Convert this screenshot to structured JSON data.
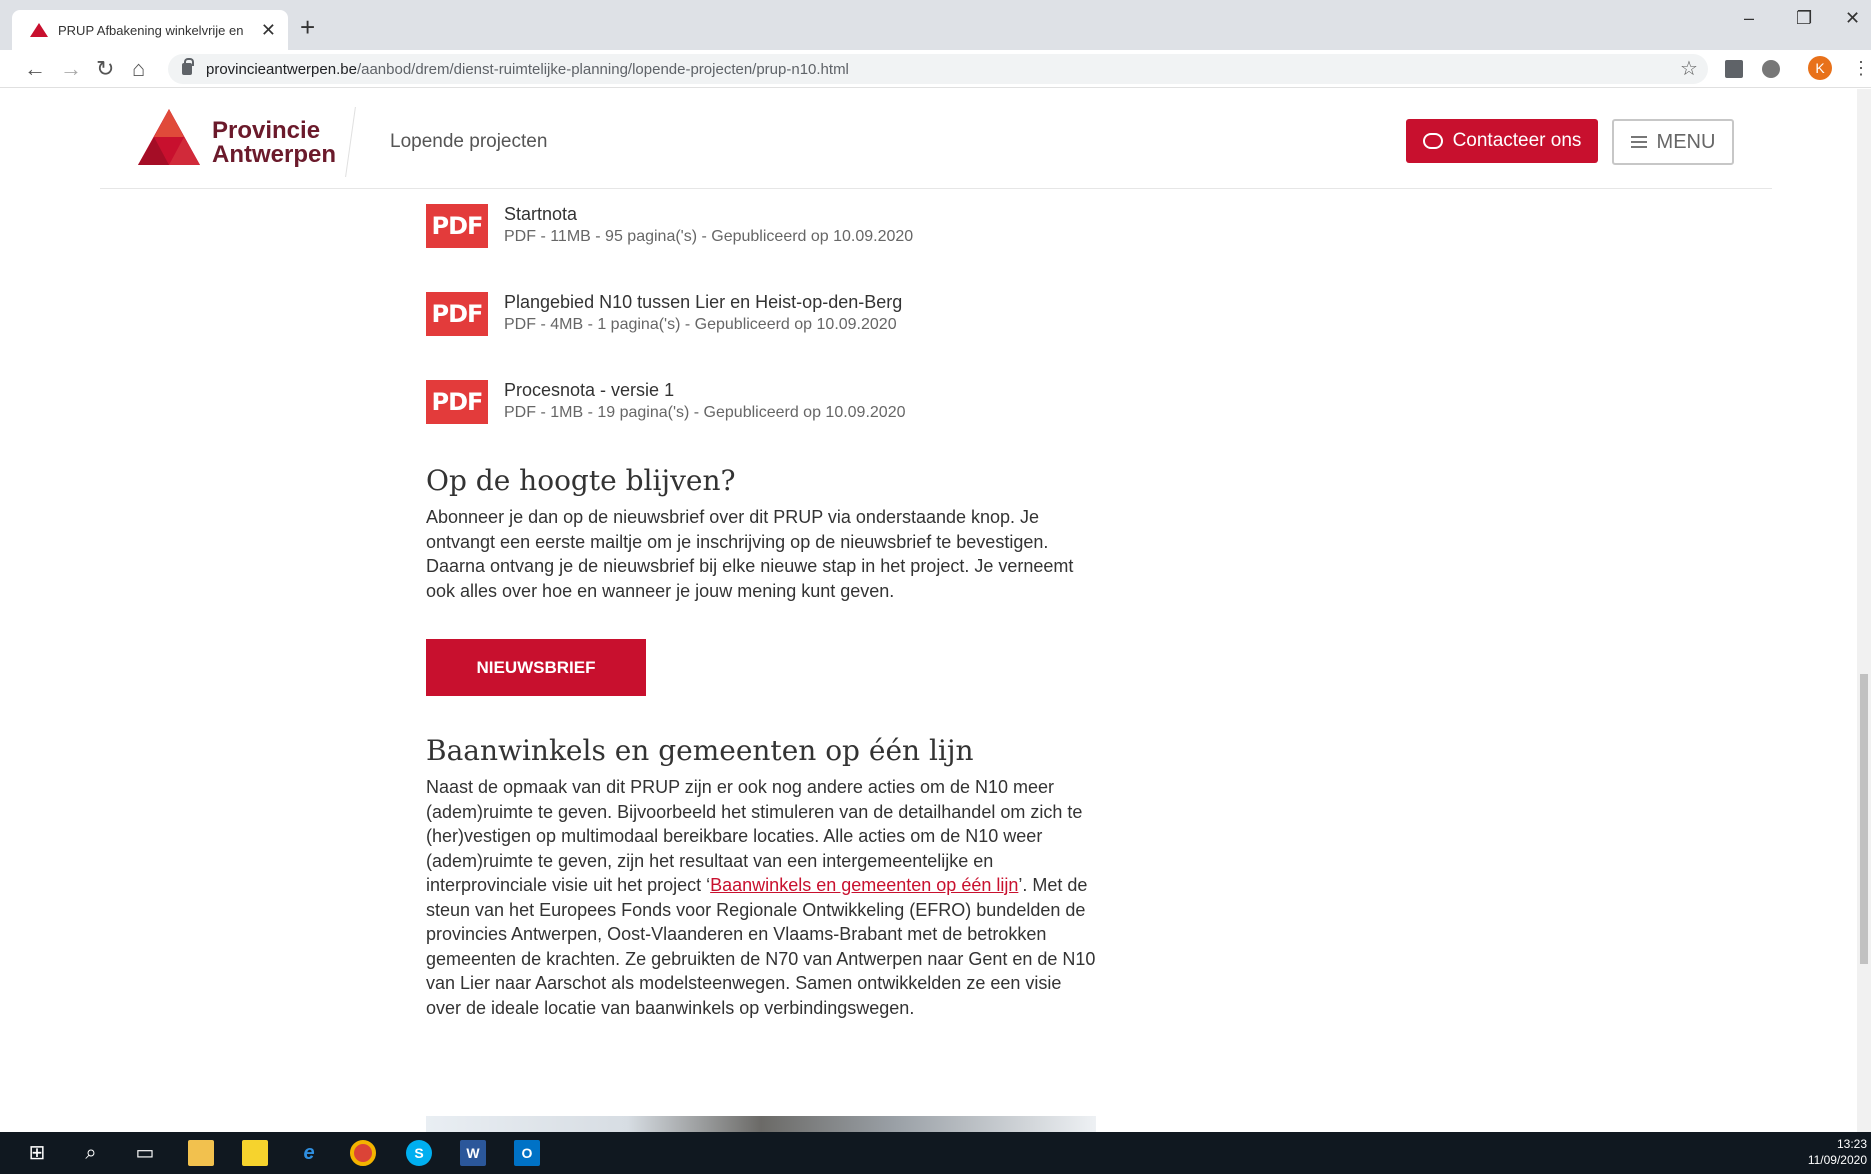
{
  "browser": {
    "tab_title": "PRUP Afbakening winkelvrije en",
    "url_host": "provincieantwerpen.be",
    "url_path": "/aanbod/drem/dienst-ruimtelijke-planning/lopende-projecten/prup-n10.html",
    "profile_initial": "K"
  },
  "header": {
    "logo_line1": "Provincie",
    "logo_line2": "Antwerpen",
    "section": "Lopende projecten",
    "contact_label": "Contacteer ons",
    "menu_label": "MENU"
  },
  "documents": [
    {
      "badge": "PDF",
      "title": "Startnota",
      "meta": "PDF - 11MB - 95 pagina('s) - Gepubliceerd op 10.09.2020"
    },
    {
      "badge": "PDF",
      "title": "Plangebied N10 tussen Lier en Heist-op-den-Berg",
      "meta": "PDF - 4MB - 1 pagina('s) - Gepubliceerd op 10.09.2020"
    },
    {
      "badge": "PDF",
      "title": "Procesnota - versie 1",
      "meta": "PDF - 1MB - 19 pagina('s) - Gepubliceerd op 10.09.2020"
    }
  ],
  "newsletter": {
    "heading": "Op de hoogte blijven?",
    "body": "Abonneer je dan op de nieuwsbrief over dit PRUP via onderstaande knop. Je ontvangt een eerste mailtje om je inschrijving op de nieuwsbrief te bevestigen. Daarna ontvang je de nieuwsbrief bij elke nieuwe stap in het project. Je verneemt ook alles over hoe en wanneer je jouw mening kunt geven.",
    "button": "NIEUWSBRIEF"
  },
  "baanwinkels": {
    "heading": "Baanwinkels en gemeenten op één lijn",
    "text_before": "Naast de opmaak van dit PRUP zijn er ook nog andere acties om de N10 meer (adem)ruimte te geven. Bijvoorbeeld het stimuleren van de detailhandel om zich te (her)vestigen op multimodaal bereikbare locaties. Alle acties om de N10 weer (adem)ruimte te geven, zijn het resultaat van een intergemeentelijke en interprovinciale visie uit het project ‘",
    "link": "Baanwinkels en gemeenten op één lijn",
    "text_after": "’. Met de steun van het Europees Fonds voor Regionale Ontwikkeling (EFRO) bundelden de provincies Antwerpen, Oost-Vlaanderen en Vlaams-Brabant met de betrokken gemeenten de krachten. Ze gebruikten de N70 van Antwerpen naar Gent en de N10 van Lier naar Aarschot als modelsteenwegen. Samen ontwikkelden ze een visie over de ideale locatie van baanwinkels op verbindingswegen."
  },
  "taskbar": {
    "time": "13:23",
    "date": "11/09/2020"
  },
  "colors": {
    "brand_red": "#c8102e",
    "pdf_red": "#e33b3b",
    "logo_text": "#6b1a2b"
  }
}
